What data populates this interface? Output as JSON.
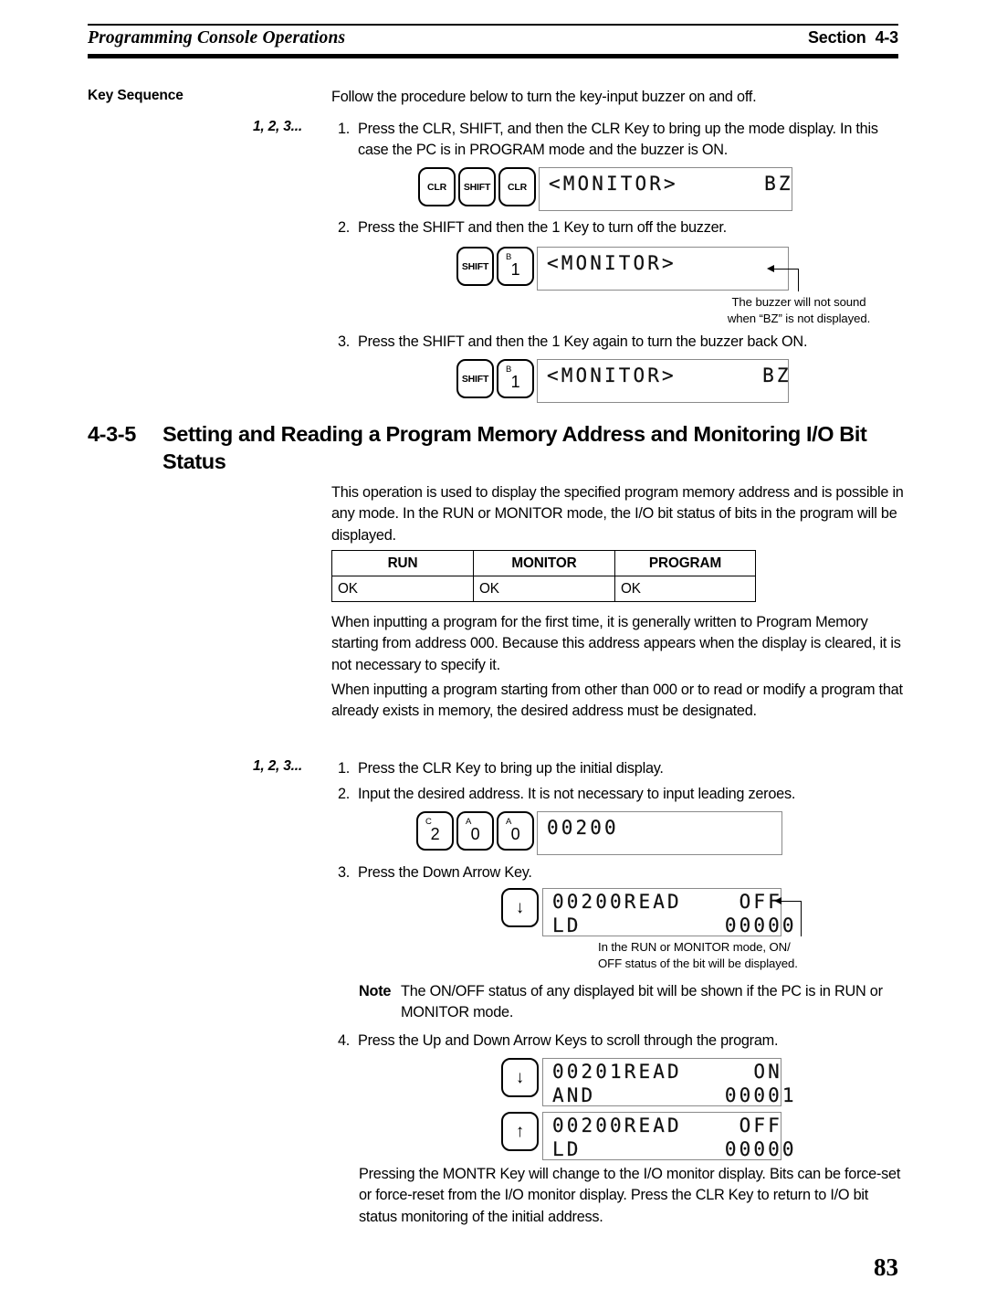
{
  "header": {
    "left_title": "Programming Console Operations",
    "section_word": "Section",
    "section_number": "4-3"
  },
  "key_sequence": {
    "label": "Key Sequence",
    "intro": "Follow the procedure below to turn the key-input buzzer on and off.",
    "enum_marker": "1, 2, 3...",
    "steps": [
      {
        "num": "1.",
        "text": "Press the CLR, SHIFT, and then the CLR Key to bring up the mode display. In this case the PC is in PROGRAM mode and the buzzer is ON."
      },
      {
        "num": "2.",
        "text": "Press the SHIFT and then the 1 Key to turn off the buzzer."
      },
      {
        "num": "3.",
        "text": "Press the SHIFT and then the 1 Key again to turn the buzzer back ON."
      }
    ],
    "keys_step1": [
      {
        "type": "word",
        "label": "CLR"
      },
      {
        "type": "word",
        "label": "SHIFT"
      },
      {
        "type": "word",
        "label": "CLR"
      }
    ],
    "keys_step2": [
      {
        "type": "word",
        "label": "SHIFT"
      },
      {
        "type": "dual",
        "sup": "B",
        "big": "1"
      }
    ],
    "keys_step3": [
      {
        "type": "word",
        "label": "SHIFT"
      },
      {
        "type": "dual",
        "sup": "B",
        "big": "1"
      }
    ],
    "display_step1": [
      "<MONITOR>      BZ"
    ],
    "display_step2": [
      "<MONITOR>"
    ],
    "display_step3": [
      "<MONITOR>      BZ"
    ],
    "callout_buzzer": "The buzzer will not sound\nwhen “BZ” is not displayed."
  },
  "section": {
    "id": "4-3-5",
    "title": "Setting and Reading a Program Memory Address and Monitoring I/O Bit Status",
    "intro": "This operation is used to display the specified program memory address and is possible in any mode. In the RUN or MONITOR mode, the I/O bit status of bits in the program will be displayed.",
    "para_first_time": "When inputting a program for the first time, it is generally written to Program Memory starting from address 000. Because this address appears when the display is cleared, it is not necessary to specify it.",
    "para_other": "When inputting a program starting from other than 000 or to read or modify a program that already exists in memory, the desired address must be designated.",
    "closing": "Pressing the MONTR Key will change to the I/O monitor display. Bits can be force-set or force-reset from the I/O monitor display. Press the CLR Key to return to I/O bit status monitoring of the initial address."
  },
  "mode_table": {
    "headers": [
      "RUN",
      "MONITOR",
      "PROGRAM"
    ],
    "rows": [
      [
        "OK",
        "OK",
        "OK"
      ]
    ]
  },
  "procedure": {
    "enum_marker": "1, 2, 3...",
    "steps": [
      {
        "num": "1.",
        "text": "Press the CLR Key to bring up the initial display."
      },
      {
        "num": "2.",
        "text": "Input the desired address. It is not necessary to input leading zeroes."
      },
      {
        "num": "3.",
        "text": "Press the Down Arrow Key."
      },
      {
        "num": "4.",
        "text": "Press the Up and Down Arrow Keys to scroll through the program."
      }
    ],
    "keys_address": [
      {
        "type": "dual",
        "sup": "C",
        "big": "2"
      },
      {
        "type": "dual",
        "sup": "A",
        "big": "0"
      },
      {
        "type": "dual",
        "sup": "A",
        "big": "0"
      }
    ],
    "display_address": [
      "00200"
    ],
    "key_down": {
      "type": "arrow",
      "glyph": "↓"
    },
    "key_up": {
      "type": "arrow",
      "glyph": "↑"
    },
    "display_read_off": [
      "00200READ    OFF",
      "LD          00000"
    ],
    "display_read_on": [
      "00201READ     ON",
      "AND         00001"
    ],
    "display_read_off2": [
      "00200READ    OFF",
      "LD          00000"
    ],
    "callout_status": "In the RUN or MONITOR mode, ON/\nOFF status of the bit will be displayed.",
    "note": {
      "word": "Note",
      "text": "The ON/OFF status of any displayed bit will be shown if the PC is in RUN or MONITOR mode."
    }
  },
  "page_number": "83"
}
